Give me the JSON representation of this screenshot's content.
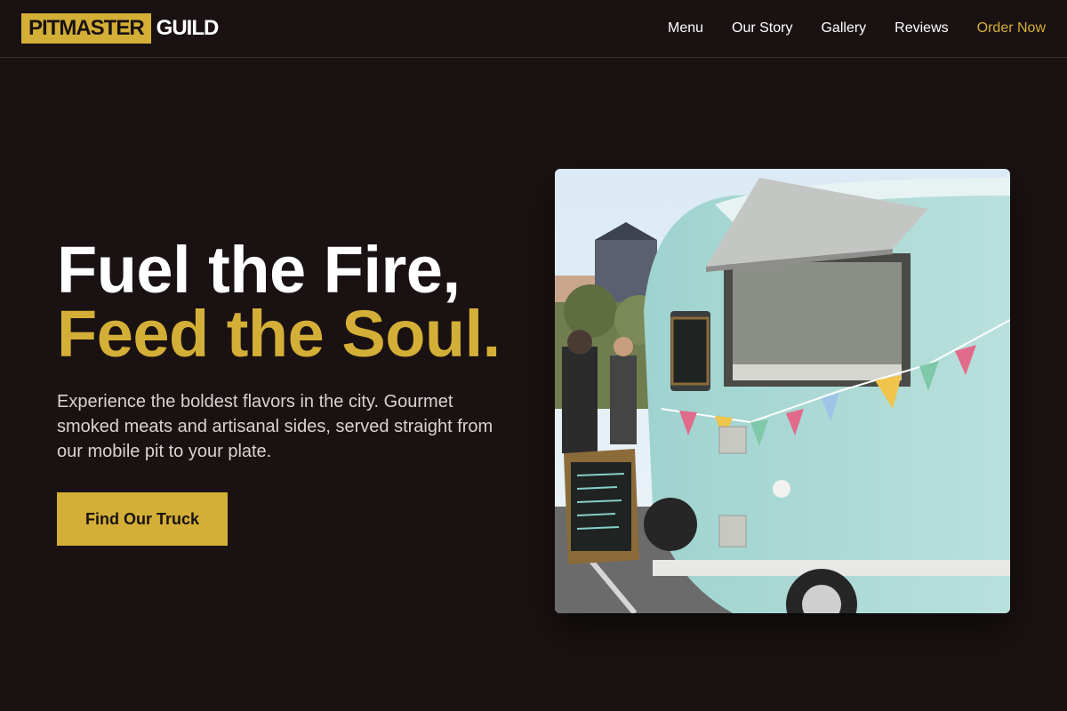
{
  "brand": {
    "primary": "PITMASTER",
    "secondary": "GUILD"
  },
  "nav": {
    "items": [
      {
        "label": "Menu"
      },
      {
        "label": "Our Story"
      },
      {
        "label": "Gallery"
      },
      {
        "label": "Reviews"
      }
    ],
    "cta_label": "Order Now"
  },
  "hero": {
    "headline_line1": "Fuel the Fire,",
    "headline_line2": "Feed the Soul.",
    "lead": "Experience the boldest flavors in the city. Gourmet smoked meats and artisanal sides, served straight from our mobile pit to your plate.",
    "cta_label": "Find Our Truck"
  },
  "colors": {
    "background": "#1a1212",
    "accent": "#d4af37",
    "text": "#ffffff",
    "muted_text": "#d8d2d2"
  },
  "image": {
    "subject": "food-truck-photo"
  }
}
